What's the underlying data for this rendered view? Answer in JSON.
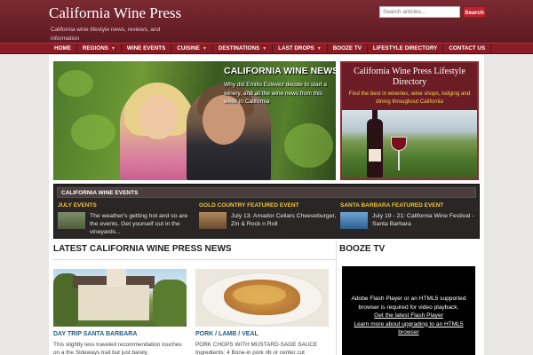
{
  "site": {
    "title": "California Wine Press",
    "tagline": "California wine lifestyle news, reviews, and information"
  },
  "search": {
    "placeholder": "Search articles...",
    "button_label": "Search"
  },
  "nav": [
    {
      "label": "HOME",
      "has_dropdown": false
    },
    {
      "label": "REGIONS",
      "has_dropdown": true
    },
    {
      "label": "WINE EVENTS",
      "has_dropdown": false
    },
    {
      "label": "CUISINE",
      "has_dropdown": true
    },
    {
      "label": "DESTINATIONS",
      "has_dropdown": true
    },
    {
      "label": "LAST DROPS",
      "has_dropdown": true
    },
    {
      "label": "BOOZE TV",
      "has_dropdown": false
    },
    {
      "label": "LIFESTYLE DIRECTORY",
      "has_dropdown": false
    },
    {
      "label": "CONTACT US",
      "has_dropdown": false
    }
  ],
  "hero": {
    "title": "CALIFORNIA WINE NEWS",
    "description": "Why did Emilio Estevez decide to start a winery, and all the wine news from this week in California"
  },
  "directory_ad": {
    "title": "California Wine Press Lifestyle Directory",
    "subtitle": "Find the best in wineries, wine shops, lodging and dining throughout California"
  },
  "events": {
    "header": "CALIFORNIA WINE EVENTS",
    "items": [
      {
        "title": "JULY EVENTS",
        "text": "The weather's getting hot and so are the events. Get yourself out in the vineyards...",
        "thumb_color": "#6a7a55"
      },
      {
        "title": "GOLD COUNTRY FEATURED EVENT",
        "text": "July 13: Amador Cellars Cheeseburger, Zin & Rock n Roll",
        "thumb_color": "#8a6a4a"
      },
      {
        "title": "SANTA BARBARA FEATURED EVENT",
        "text": "July 19 - 21: California Wine Festival - Santa Barbara",
        "thumb_color": "#4a7fb0"
      }
    ]
  },
  "latest": {
    "heading": "LATEST CALIFORNIA WINE PRESS NEWS",
    "articles": [
      {
        "category": "DAY TRIP SANTA BARBARA",
        "description": "This slightly less traveled recommendation touches on a the Sideways trail but just barely."
      },
      {
        "category": "PORK / LAMB / VEAL",
        "description": "PORK CHOPS WITH MUSTARD-SAGE SAUCE Ingredients: 4 Bone-in pork rib or center cut"
      }
    ]
  },
  "booze_tv": {
    "heading": "BOOZE TV",
    "message": "Adobe Flash Player or an HTML5 supported browser is required for video playback.",
    "link1": "Get the latest Flash Player",
    "link2": "Learn more about upgrading to an HTML5 browser"
  },
  "colors": {
    "header": "#6b2129",
    "nav": "#8b1b24",
    "accent_yellow": "#f0c53a",
    "link_blue": "#1d5f86"
  }
}
